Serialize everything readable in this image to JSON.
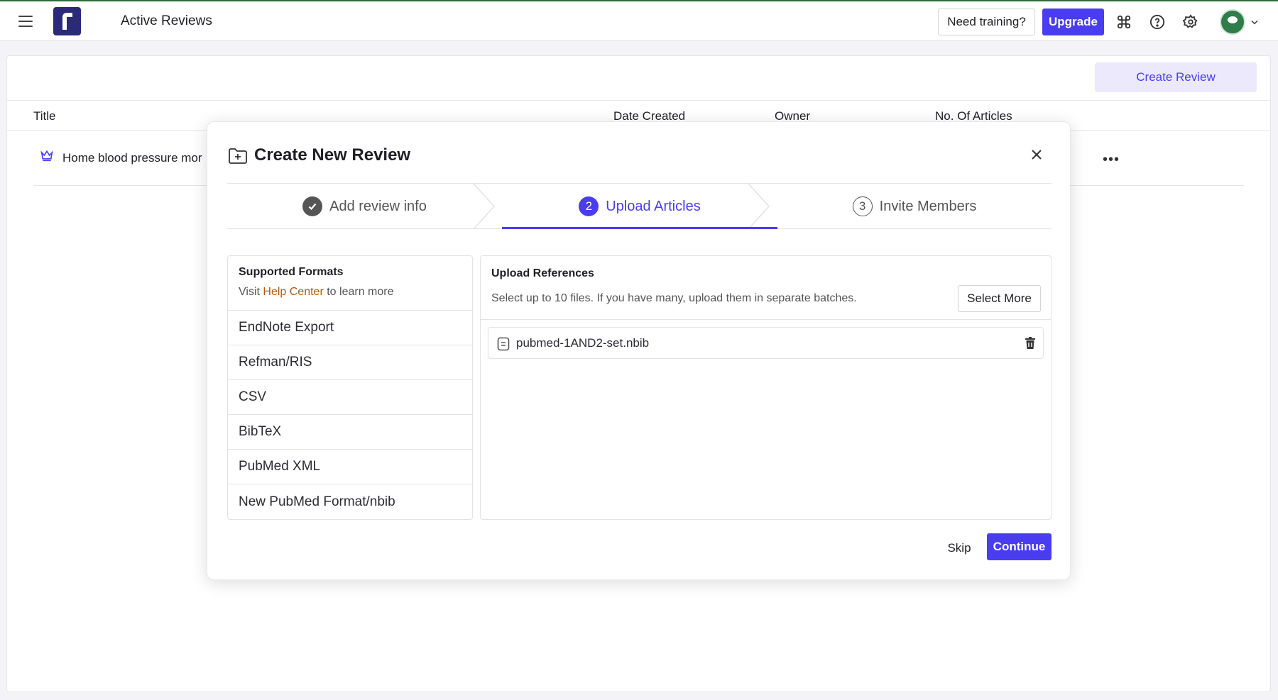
{
  "header": {
    "title": "Active Reviews",
    "training_label": "Need training?",
    "upgrade_label": "Upgrade",
    "icons": [
      "menu-icon",
      "app-logo",
      "command-icon",
      "help-icon",
      "gear-icon",
      "avatar",
      "chevron-down-icon"
    ]
  },
  "page": {
    "create_review_label": "Create Review",
    "columns": [
      "Title",
      "Date Created",
      "Owner",
      "No. Of Articles"
    ],
    "rows": [
      {
        "title": "Home blood pressure mor",
        "icon": "crown-icon"
      }
    ]
  },
  "modal": {
    "title": "Create New Review",
    "steps": [
      {
        "number": "✓",
        "label": "Add review info",
        "state": "completed"
      },
      {
        "number": "2",
        "label": "Upload Articles",
        "state": "active"
      },
      {
        "number": "3",
        "label": "Invite Members",
        "state": "upcoming"
      }
    ],
    "formats": {
      "title": "Supported Formats",
      "sub_prefix": "Visit",
      "sub_link": "Help Center",
      "sub_suffix": "to learn more",
      "items": [
        "EndNote Export",
        "Refman/RIS",
        "CSV",
        "BibTeX",
        "PubMed XML",
        "New PubMed Format/nbib"
      ]
    },
    "uploads": {
      "title": "Upload References",
      "subtitle": "Select up to 10 files. If you have many, upload them in separate batches.",
      "select_more_label": "Select More",
      "files": [
        {
          "name": "pubmed-1AND2-set.nbib"
        }
      ]
    },
    "skip_label": "Skip",
    "continue_label": "Continue"
  },
  "colors": {
    "accent": "#4a3df0",
    "accent_light": "#ebe9fb",
    "link": "#b05a12",
    "brand": "#2b2a7a"
  }
}
